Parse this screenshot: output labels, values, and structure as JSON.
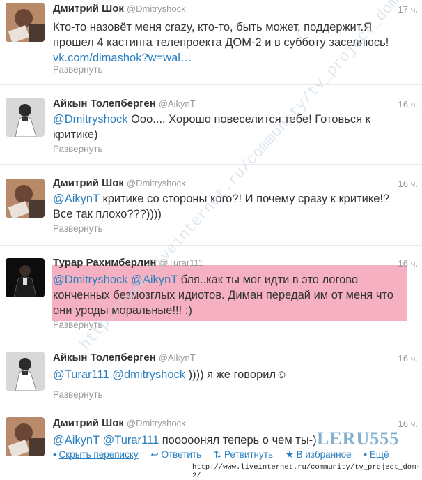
{
  "tweets": [
    {
      "name": "Дмитрий Шок",
      "handle": "@Dmitryshock",
      "time": "17 ч.",
      "lines": [
        "Кто-то назовёт меня crazy, кто-то, быть может, поддержит.Я",
        "прошел 4 кастинга телепроекта ДОМ-2 и в субботу заселяюсь!"
      ],
      "link": "vk.com/dimashok?w=wal…",
      "expand": "Развернуть"
    },
    {
      "name": "Айкын Толепберген",
      "handle": "@AikynT",
      "time": "16 ч.",
      "mention": "@Dmitryshock",
      "line1_rest": " Ооо.... Хорошо повеселится тебе! Готовься к",
      "line2": "критике)",
      "expand": "Развернуть"
    },
    {
      "name": "Дмитрий Шок",
      "handle": "@Dmitryshock",
      "time": "16 ч.",
      "mention": "@AikynT",
      "line1_rest": " критике со стороны кого?! И почему сразу к критике!?",
      "line2": "Все так плохо???))))",
      "expand": "Развернуть"
    },
    {
      "name": "Турар Рахимберлин",
      "handle": "@Turar111",
      "time": "16 ч.",
      "mention1": "@Dmitryshock",
      "mention2": "@AikynT",
      "line1_rest": " бля..как ты мог идти в это логово",
      "line2": "конченных безмозглых идиотов. Диман передай им от меня что",
      "line3": "они уроды моральные!!! :)",
      "expand": "Развернуть"
    },
    {
      "name": "Айкын Толепберген",
      "handle": "@AikynT",
      "time": "16 ч.",
      "mention1": "@Turar111",
      "mention2": "@dmitryshock",
      "rest": " )))) я же говорил☺",
      "expand": "Развернуть"
    },
    {
      "name": "Дмитрий Шок",
      "handle": "@Dmitryshock",
      "time": "16 ч.",
      "mention1": "@AikynT",
      "mention2": "@Turar111",
      "rest": " пооооонял теперь о чем ты-)"
    }
  ],
  "actions": {
    "hide": "Скрыть переписку",
    "reply": "Ответить",
    "retweet": "Ретвитнуть",
    "favorite": "В избранное",
    "more": "Ещё"
  },
  "watermark": {
    "logo": "LERU555",
    "diag": "http://www.liveinternet.ru/community/tv_project_dom-2/",
    "url": "http://www.liveinternet.ru/community/tv_project_dom-2/"
  },
  "colors": {
    "link": "#2a7fc0",
    "highlight": "#f4a9ba",
    "muted": "#999999"
  }
}
